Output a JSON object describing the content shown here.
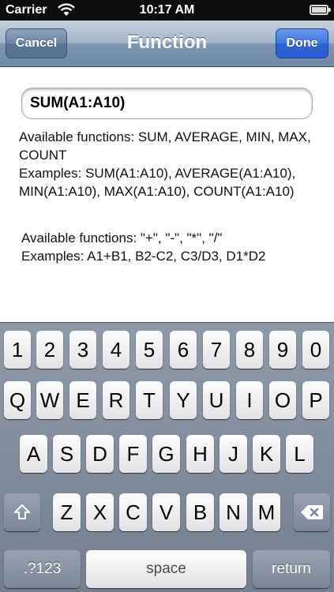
{
  "status_bar": {
    "carrier": "Carrier",
    "time": "10:17 AM"
  },
  "nav": {
    "title": "Function",
    "cancel_label": "Cancel",
    "done_label": "Done"
  },
  "formula": {
    "value": "SUM(A1:A10)"
  },
  "help": {
    "functions_line1": "Available functions: SUM, AVERAGE, MIN, MAX,",
    "functions_line2": "COUNT",
    "examples_line1": "Examples: SUM(A1:A10), AVERAGE(A1:A10),",
    "examples_line2": "MIN(A1:A10), MAX(A1:A10), COUNT(A1:A10)",
    "operators_line": "Available functions: \"+\", \"-\", \"*\", \"/\"",
    "operator_examples_line": "Examples: A1+B1, B2-C2, C3/D3, D1*D2"
  },
  "keyboard": {
    "row1": [
      "1",
      "2",
      "3",
      "4",
      "5",
      "6",
      "7",
      "8",
      "9",
      "0"
    ],
    "row2": [
      "Q",
      "W",
      "E",
      "R",
      "T",
      "Y",
      "U",
      "I",
      "O",
      "P"
    ],
    "row3": [
      "A",
      "S",
      "D",
      "F",
      "G",
      "H",
      "J",
      "K",
      "L"
    ],
    "row4": [
      "Z",
      "X",
      "C",
      "V",
      "B",
      "N",
      "M"
    ],
    "mode_label": ".?123",
    "space_label": "space",
    "return_label": "return",
    "shift_icon": "shift-arrow-icon",
    "delete_icon": "backspace-icon"
  },
  "colors": {
    "nav_accent": "#6e87a3",
    "done_button": "#2c63d8",
    "keyboard_bg": "#7b8697"
  }
}
